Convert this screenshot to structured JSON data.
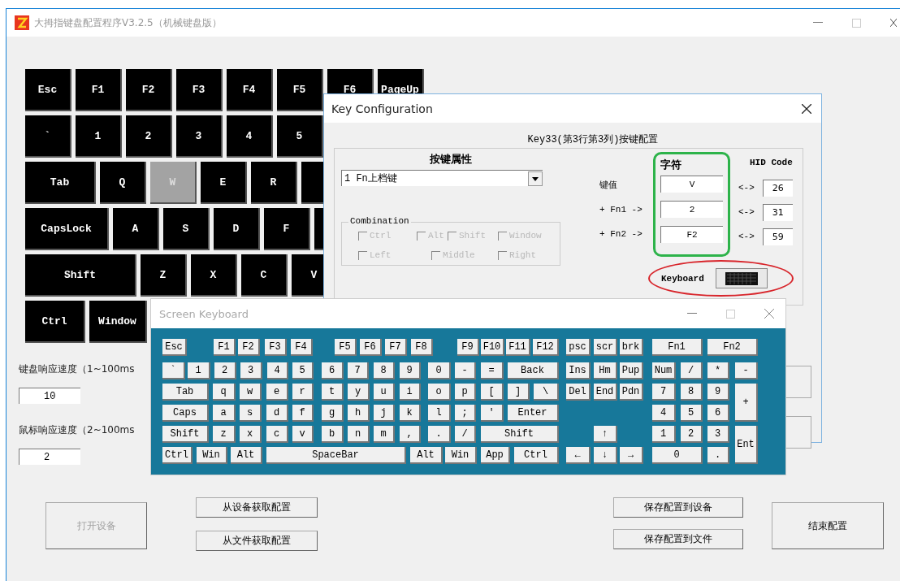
{
  "window": {
    "title": "大拇指键盘配置程序V3.2.5（机械键盘版）"
  },
  "main_keyboard": {
    "rows": [
      [
        {
          "label": "Esc",
          "kind": "std",
          "selected": false
        },
        {
          "label": "F1",
          "kind": "std",
          "selected": false
        },
        {
          "label": "F2",
          "kind": "std",
          "selected": false
        },
        {
          "label": "F3",
          "kind": "std",
          "selected": false
        },
        {
          "label": "F4",
          "kind": "std",
          "selected": false
        },
        {
          "label": "F5",
          "kind": "std",
          "selected": false
        },
        {
          "label": "F6",
          "kind": "std",
          "selected": false
        },
        {
          "label": "PageUp",
          "kind": "std",
          "selected": false
        }
      ],
      [
        {
          "label": "`",
          "kind": "std",
          "selected": false
        },
        {
          "label": "1",
          "kind": "std",
          "selected": false
        },
        {
          "label": "2",
          "kind": "std",
          "selected": false
        },
        {
          "label": "3",
          "kind": "std",
          "selected": false
        },
        {
          "label": "4",
          "kind": "std",
          "selected": false
        },
        {
          "label": "5",
          "kind": "std",
          "selected": false
        }
      ],
      [
        {
          "label": "Tab",
          "kind": "tab",
          "selected": false
        },
        {
          "label": "Q",
          "kind": "std",
          "selected": false
        },
        {
          "label": "W",
          "kind": "std",
          "selected": true
        },
        {
          "label": "E",
          "kind": "std",
          "selected": false
        },
        {
          "label": "R",
          "kind": "std",
          "selected": false
        },
        {
          "kind": "std",
          "selected": false
        }
      ],
      [
        {
          "label": "CapsLock",
          "kind": "caps",
          "selected": false
        },
        {
          "label": "A",
          "kind": "std",
          "selected": false
        },
        {
          "label": "S",
          "kind": "std",
          "selected": false
        },
        {
          "label": "D",
          "kind": "std",
          "selected": false
        },
        {
          "label": "F",
          "kind": "std",
          "selected": false
        },
        {
          "kind": "std",
          "selected": false
        }
      ],
      [
        {
          "label": "Shift",
          "kind": "shift",
          "selected": false
        },
        {
          "label": "Z",
          "kind": "std",
          "selected": false
        },
        {
          "label": "X",
          "kind": "std",
          "selected": false
        },
        {
          "label": "C",
          "kind": "std",
          "selected": false
        },
        {
          "label": "V",
          "kind": "std",
          "selected": false
        }
      ],
      [
        {
          "label": "Ctrl",
          "kind": "ctrl",
          "selected": false
        },
        {
          "label": "Window",
          "kind": "win",
          "selected": false
        }
      ]
    ]
  },
  "settings": [
    {
      "label": "键盘响应速度（1~100ms",
      "value": "10"
    },
    {
      "label": "鼠标响应速度（2~100ms",
      "value": "2"
    }
  ],
  "button_groups": [
    [
      {
        "label": "打开设备",
        "disabled": true
      }
    ],
    [
      {
        "label": "从设备获取配置",
        "disabled": false
      },
      {
        "label": "从文件获取配置",
        "disabled": false
      }
    ],
    [
      {
        "label": "保存配置到设备",
        "disabled": false
      },
      {
        "label": "保存配置到文件",
        "disabled": false
      }
    ],
    [
      {
        "label": "结束配置",
        "disabled": false
      }
    ]
  ],
  "key_config": {
    "title": "Key Configuration",
    "heading": "Key33(第3行第3列)按键配置",
    "attribute_label": "按键属性",
    "attribute_value": "1 Fn上档键",
    "combination": {
      "label": "Combination",
      "options": [
        {
          "label": "Ctrl",
          "checked": false,
          "disabled": true
        },
        {
          "label": "Alt",
          "checked": false,
          "disabled": true
        },
        {
          "label": "Shift",
          "checked": false,
          "disabled": true
        },
        {
          "label": "Window",
          "checked": false,
          "disabled": true
        },
        {
          "label": "Left",
          "checked": false,
          "disabled": true
        },
        {
          "label": "Middle",
          "checked": false,
          "disabled": true
        },
        {
          "label": "Right",
          "checked": false,
          "disabled": true
        }
      ]
    },
    "char_header": "字符",
    "hid_header": "HID Code",
    "mapping": [
      {
        "label": "键值",
        "char": "V",
        "arrow": "<->",
        "hid": "26"
      },
      {
        "label": "+ Fn1 ->",
        "char": "2",
        "arrow": "<->",
        "hid": "31"
      },
      {
        "label": "+ Fn2 ->",
        "char": "F2",
        "arrow": "<->",
        "hid": "59"
      }
    ],
    "keyboard_label": "Keyboard"
  },
  "screen_keyboard": {
    "title": "Screen Keyboard",
    "function_keys": [
      "Esc",
      "F1",
      "F2",
      "F3",
      "F4",
      "F5",
      "F6",
      "F7",
      "F8",
      "F9",
      "F10",
      "F11",
      "F12"
    ],
    "system_keys": [
      "psc",
      "scr",
      "brk"
    ],
    "fn_keys": [
      "Fn1",
      "Fn2"
    ],
    "main_keys": [
      "`",
      "1",
      "2",
      "3",
      "4",
      "5",
      "6",
      "7",
      "8",
      "9",
      "0",
      "-",
      "=",
      "Back",
      "Tab",
      "q",
      "w",
      "e",
      "r",
      "t",
      "y",
      "u",
      "i",
      "o",
      "p",
      "[",
      "]",
      "\\",
      "Caps",
      "a",
      "s",
      "d",
      "f",
      "g",
      "h",
      "j",
      "k",
      "l",
      ";",
      "'",
      "Enter",
      "Shift",
      "z",
      "x",
      "c",
      "v",
      "b",
      "n",
      "m",
      ",",
      ".",
      "/",
      "Shift",
      "Ctrl",
      "Win",
      "Alt",
      "SpaceBar",
      "Alt",
      "Win",
      "App",
      "Ctrl"
    ],
    "edit_keys": [
      "Ins",
      "Hm",
      "Pup",
      "Del",
      "End",
      "Pdn"
    ],
    "arrow_keys": [
      "↑",
      "←",
      "↓",
      "→"
    ],
    "numpad_keys": [
      "Num",
      "/",
      "*",
      "-",
      "7",
      "8",
      "9",
      "+",
      "4",
      "5",
      "6",
      "1",
      "2",
      "3",
      "Ent",
      "0",
      "."
    ]
  }
}
